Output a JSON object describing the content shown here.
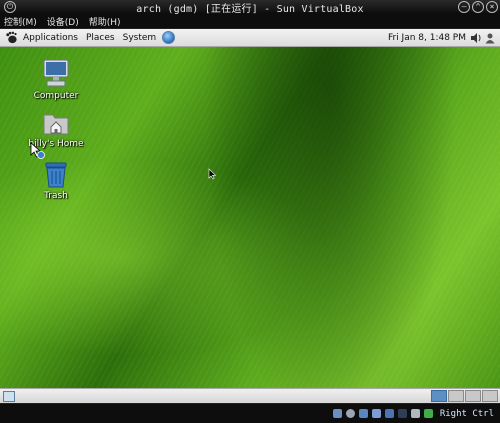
{
  "window": {
    "title": "arch (gdm) [正在运行] - Sun VirtualBox"
  },
  "vbox_menu": [
    {
      "label": "控制(M)"
    },
    {
      "label": "设备(D)"
    },
    {
      "label": "帮助(H)"
    }
  ],
  "gnome_panel": {
    "menus": [
      {
        "label": "Applications"
      },
      {
        "label": "Places"
      },
      {
        "label": "System"
      }
    ],
    "clock": "Fri Jan  8,  1:48 PM"
  },
  "desktop_icons": [
    {
      "label": "Computer",
      "icon": "computer-icon"
    },
    {
      "label": "billy's Home",
      "icon": "home-folder-icon"
    },
    {
      "label": "Trash",
      "icon": "trash-icon"
    }
  ],
  "workspaces": {
    "count": 4,
    "active_index": 0
  },
  "status_bar": {
    "host_key": "Right Ctrl"
  },
  "colors": {
    "desktop_green": "#4a9614",
    "panel_light": "#e8e8e8",
    "chrome_dark": "#0d0d0d",
    "workspace_active": "#5d8fc4"
  }
}
